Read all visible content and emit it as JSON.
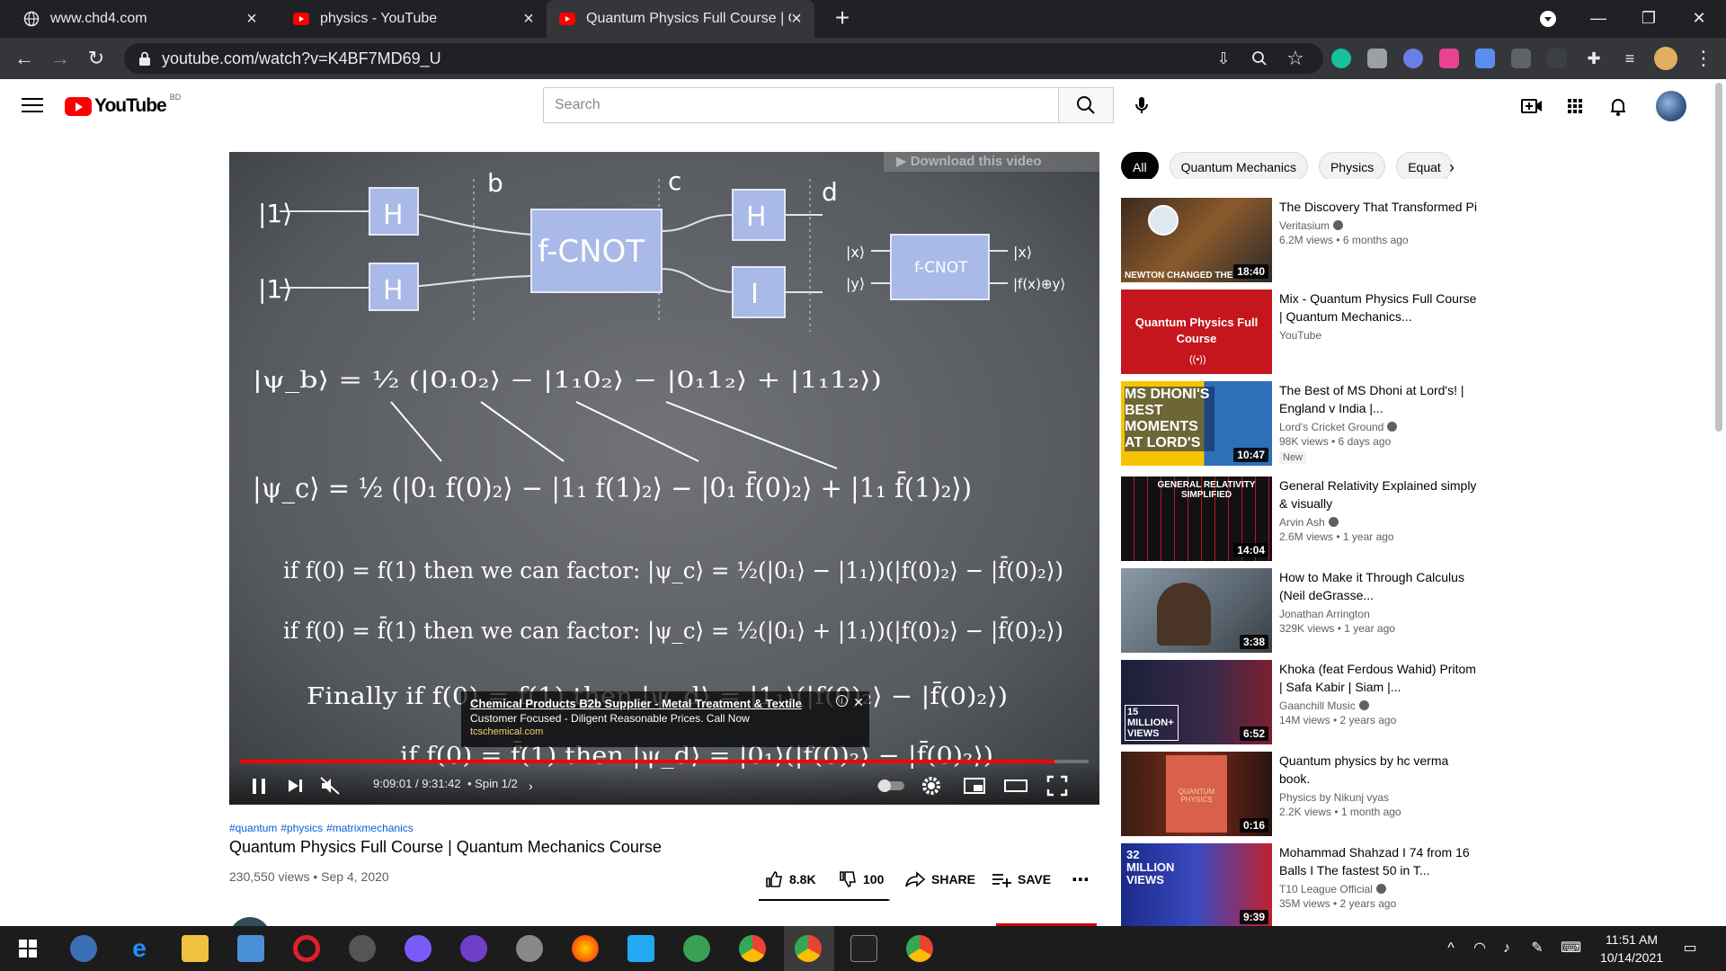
{
  "browser": {
    "tabs": [
      {
        "title": "www.chd4.com",
        "active": false
      },
      {
        "title": "physics - YouTube",
        "active": false
      },
      {
        "title": "Quantum Physics Full Course | Qu",
        "active": true
      }
    ],
    "url": "youtube.com/watch?v=K4BF7MD69_U"
  },
  "youtube": {
    "logo_text": "YouTube",
    "country": "BD",
    "search_placeholder": "Search"
  },
  "player": {
    "download_badge": "▶ Download this video",
    "ad": {
      "title": "Chemical Products B2b Supplier - Metal Treatment & Textile",
      "subtitle": "Customer Focused - Diligent Reasonable Prices. Call Now",
      "url": "tcschemical.com"
    },
    "time": "9:09:01 / 9:31:42",
    "chapter": "• Spin 1/2",
    "progress_fraction": 0.9593,
    "board": {
      "labels": [
        "b",
        "c",
        "d"
      ],
      "ket1": "|1⟩",
      "gate_h": "H",
      "gate_i": "I",
      "gate_fcnot": "f-CNOT",
      "small_x_in": "|x⟩",
      "small_y_in": "|y⟩",
      "small_x_out": "|x⟩",
      "small_y_out": "|f(x)⊕y⟩",
      "eq_b": "|ψ_b⟩ = ½ (|0₁0₂⟩ − |1₁0₂⟩ − |0₁1₂⟩ + |1₁1₂⟩)",
      "eq_c": "|ψ_c⟩ = ½ (|0₁ f(0)₂⟩ − |1₁ f(1)₂⟩ − |0₁ f̄(0)₂⟩ + |1₁ f̄(1)₂⟩)",
      "line1": "if f(0) = f(1) then we can factor: |ψ_c⟩ = ½(|0₁⟩ − |1₁⟩)(|f(0)₂⟩ − |f̄(0)₂⟩)",
      "line2": "if f(0) = f̄(1) then we can factor: |ψ_c⟩ = ½(|0₁⟩ + |1₁⟩)(|f(0)₂⟩ − |f̄(0)₂⟩)",
      "line3": "Finally if f(0) = f(1) then |ψ_d⟩ = |1₁⟩(|f(0)₂⟩ − |f̄(0)₂⟩)",
      "line4": "if f(0) = f̄(1) then |ψ_d⟩ = |0₁⟩(|f(0)₂⟩ − |f̄(0)₂⟩)"
    }
  },
  "video": {
    "hashtags": [
      "#quantum",
      "#physics",
      "#matrixmechanics"
    ],
    "title": "Quantum Physics Full Course | Quantum Mechanics Course",
    "meta": "230,550 views • Sep 4, 2020",
    "likes": "8.8K",
    "dislikes": "100",
    "share": "SHARE",
    "save": "SAVE",
    "like_ratio": 0.9888
  },
  "chips": [
    "All",
    "Quantum Mechanics",
    "Physics",
    "Equat"
  ],
  "recommendations": [
    {
      "title": "The Discovery That Transformed Pi",
      "channel": "Veritasium",
      "verified": true,
      "views": "6.2M views • 6 months ago",
      "duration": "18:40",
      "thumb_text": "NEWTON CHANGED THE",
      "badge": ""
    },
    {
      "title": "Mix - Quantum Physics Full Course | Quantum Mechanics...",
      "channel": "YouTube",
      "verified": false,
      "views": "",
      "duration": "",
      "thumb_text": "Quantum Physics Full Course",
      "badge": ""
    },
    {
      "title": "The Best of MS Dhoni at Lord's! | England v India |...",
      "channel": "Lord's Cricket Ground",
      "verified": true,
      "views": "98K views • 6 days ago",
      "duration": "10:47",
      "thumb_text": "MS DHONI'S BEST MOMENTS AT LORD'S",
      "badge": "New"
    },
    {
      "title": "General Relativity Explained simply & visually",
      "channel": "Arvin Ash",
      "verified": true,
      "views": "2.6M views • 1 year ago",
      "duration": "14:04",
      "thumb_text": "GENERAL RELATIVITY SIMPLIFIED",
      "badge": ""
    },
    {
      "title": "How to Make it Through Calculus (Neil deGrasse...",
      "channel": "Jonathan Arrington",
      "verified": false,
      "views": "329K views • 1 year ago",
      "duration": "3:38",
      "thumb_text": "",
      "badge": ""
    },
    {
      "title": "Khoka (feat Ferdous Wahid) Pritom | Safa Kabir | Siam |...",
      "channel": "Gaanchill Music",
      "verified": true,
      "views": "14M views • 2 years ago",
      "duration": "6:52",
      "thumb_text": "15 MILLION+ VIEWS",
      "badge": ""
    },
    {
      "title": "Quantum physics by hc verma book.",
      "channel": "Physics by Nikunj vyas",
      "verified": false,
      "views": "2.2K views • 1 month ago",
      "duration": "0:16",
      "thumb_text": "QUANTUM PHYSICS",
      "badge": ""
    },
    {
      "title": "Mohammad Shahzad I 74 from 16 Balls I The fastest 50 in T...",
      "channel": "T10 League Official",
      "verified": true,
      "views": "35M views • 2 years ago",
      "duration": "9:39",
      "thumb_text": "32 MILLION VIEWS",
      "badge": ""
    }
  ],
  "taskbar": {
    "time": "11:51 AM",
    "date": "10/14/2021"
  },
  "colors": {
    "brand_red": "#ff0000",
    "link_blue": "#065fd4",
    "chrome_dark": "#202124"
  }
}
